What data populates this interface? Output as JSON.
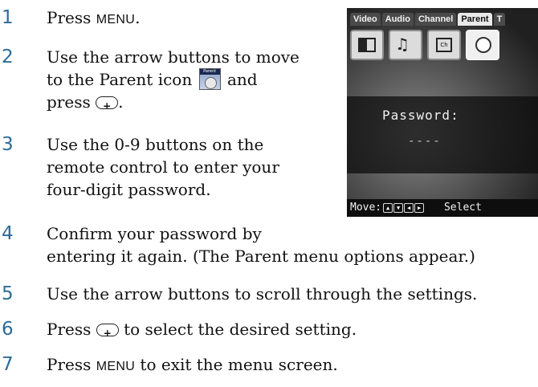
{
  "steps": [
    {
      "num": "1",
      "lines": [
        "Press MENU."
      ]
    },
    {
      "num": "2",
      "lines": [
        "Use the arrow buttons to move",
        "to the Parent icon",
        "and",
        "press",
        "."
      ]
    },
    {
      "num": "3",
      "lines": [
        "Use the 0-9 buttons on the",
        "remote control to enter your",
        "four-digit password."
      ]
    },
    {
      "num": "4",
      "lines": [
        "Confirm your password by",
        "entering it again. (The Parent menu options appear.)"
      ]
    },
    {
      "num": "5",
      "lines": [
        "Use the arrow buttons to scroll through the settings."
      ]
    },
    {
      "num": "6",
      "lines": [
        "Press",
        "to select the desired setting."
      ]
    },
    {
      "num": "7",
      "lines": [
        "Press",
        "MENU",
        "to exit the menu screen."
      ]
    }
  ],
  "step1": {
    "press": "Press",
    "menu": "MENU",
    "end": "."
  },
  "parent_icon_label": "Parent",
  "tv": {
    "tabs": [
      "Video",
      "Audio",
      "Channel",
      "Parent",
      "T"
    ],
    "active_tab": "Parent",
    "ch_icon_text": "Ch",
    "password_label": "Password:",
    "password_placeholder": "----",
    "bottom_move": "Move:",
    "bottom_select": "Select"
  }
}
